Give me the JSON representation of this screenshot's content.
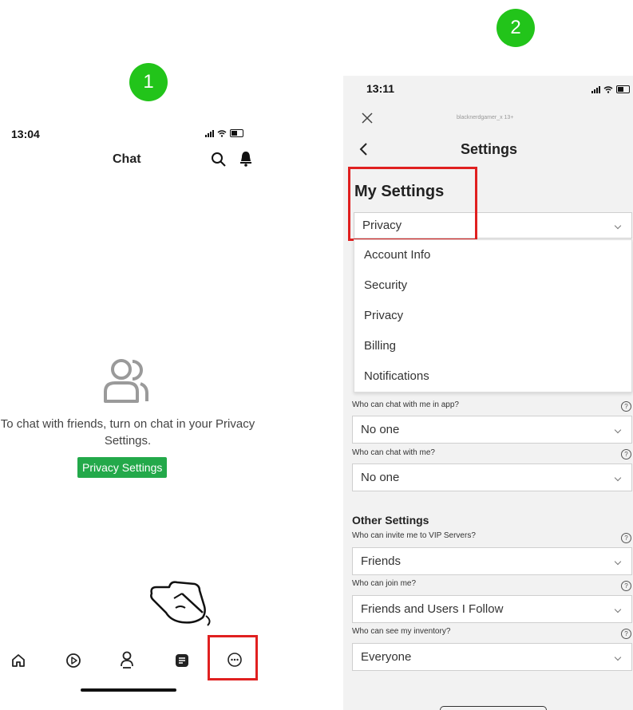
{
  "steps": {
    "first": "1",
    "second": "2"
  },
  "left": {
    "status_time": "13:04",
    "title": "Chat",
    "empty_message": "To chat with friends, turn on chat in your Privacy Settings.",
    "privacy_button": "Privacy Settings",
    "nav_icons": [
      "home-icon",
      "play-icon",
      "avatar-icon",
      "chat-icon",
      "more-icon"
    ]
  },
  "right": {
    "status_time": "13:11",
    "username": "blacknerdgamer_x 13+",
    "page_title": "Settings",
    "my_settings_heading": "My Settings",
    "selected_category": "Privacy",
    "dropdown_options": [
      "Account Info",
      "Security",
      "Privacy",
      "Billing",
      "Notifications"
    ],
    "chat_settings": [
      {
        "label": "Who can chat with me in app?",
        "value": "No one"
      },
      {
        "label": "Who can chat with me?",
        "value": "No one"
      }
    ],
    "other_heading": "Other Settings",
    "other_settings": [
      {
        "label": "Who can invite me to VIP Servers?",
        "value": "Friends"
      },
      {
        "label": "Who can join me?",
        "value": "Friends and Users I Follow"
      },
      {
        "label": "Who can see my inventory?",
        "value": "Everyone"
      }
    ]
  },
  "colors": {
    "step_green": "#22c41a",
    "button_green": "#23a94a",
    "highlight_red": "#e02020"
  }
}
